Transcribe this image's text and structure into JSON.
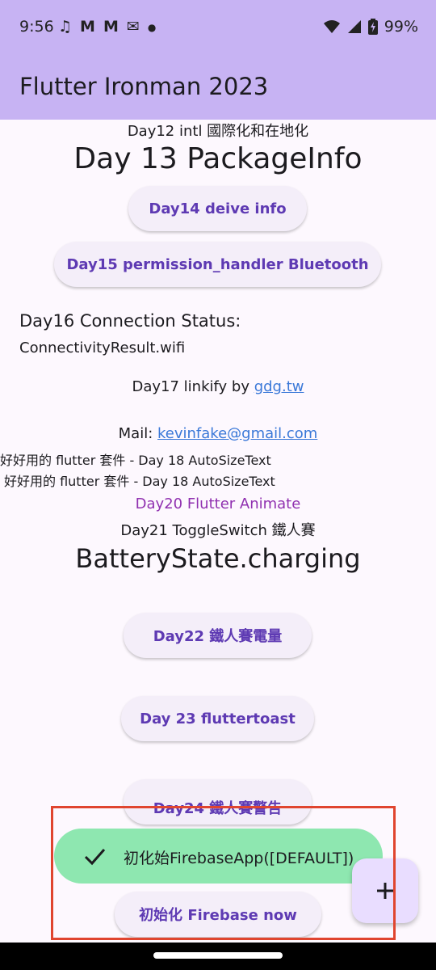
{
  "status_bar": {
    "time": "9:56",
    "notification_icons": [
      "music-note-icon",
      "gmail-icon",
      "gmail-icon",
      "mail-icon",
      "dot-icon"
    ],
    "battery": "99%"
  },
  "app_bar": {
    "title": "Flutter Ironman 2023"
  },
  "content": {
    "day12": "Day12 intl 國際化和在地化",
    "day13": "Day 13 PackageInfo",
    "day14_button": "Day14 deive info",
    "day15_button": "Day15 permission_handler Bluetooth",
    "day16_label": "Day16 Connection Status:",
    "day16_value": "ConnectivityResult.wifi",
    "day17_prefix": "Day17 linkify by ",
    "day17_link": "gdg.tw",
    "mail_prefix": "Mail: ",
    "mail_link": "kevinfake@gmail.com",
    "day18_line1": "好好用的 flutter 套件 - Day 18 AutoSizeText",
    "day18_line2": "好好用的 flutter 套件 - Day 18 AutoSizeText",
    "day20": "Day20 Flutter Animate",
    "day21": "Day21 ToggleSwitch 鐵人賽",
    "battery_state": "BatteryState.charging",
    "day22_button": "Day22 鐵人賽電量",
    "day23_button": "Day 23 fluttertoast",
    "day24_button": "Day24 鐵人賽警告",
    "firebase_button": "初始化 Firebase now"
  },
  "snackbar": {
    "message": "初化始FirebaseApp([DEFAULT])"
  },
  "fab": {
    "icon": "plus-icon"
  },
  "colors": {
    "app_bar": "#c7b3f3",
    "background": "#fdf8fe",
    "button_text": "#5e3ab3",
    "button_bg": "#f4eef9",
    "link": "#3a78d8",
    "animate_text": "#9030b0",
    "snackbar_bg": "#8ee7b0",
    "fab_bg": "#e9ddff",
    "highlight": "#e0452f"
  }
}
